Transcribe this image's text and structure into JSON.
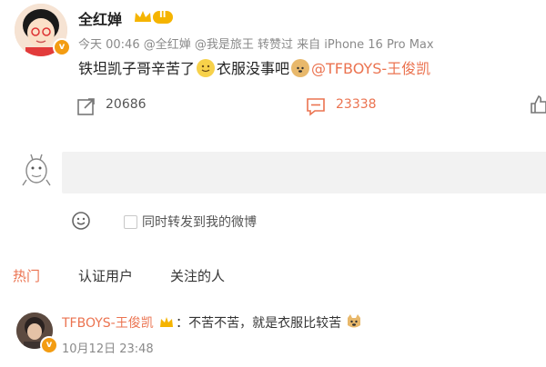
{
  "post": {
    "username": "全红婵",
    "vip_label": "II",
    "meta": "今天 00:46 @全红婵 @我是旅王 转赞过  来自 iPhone 16 Pro Max",
    "text_before": "铁坦凯子哥辛苦了",
    "text_middle": "衣服没事吧",
    "mention": "@TFBOYS-王俊凯",
    "emoji_1": "smile-emoji",
    "emoji_2": "doge-emoji"
  },
  "actions": {
    "repost_count": "20686",
    "comment_count": "23338"
  },
  "composer": {
    "placeholder": "",
    "also_repost_label": "同时转发到我的微博"
  },
  "tabs": [
    {
      "label": "热门",
      "active": true
    },
    {
      "label": "认证用户",
      "active": false
    },
    {
      "label": "关注的人",
      "active": false
    }
  ],
  "reply": {
    "username": "TFBOYS-王俊凯",
    "text": "：不苦不苦，就是衣服比较苦",
    "time": "10月12日 23:48"
  },
  "colors": {
    "accent": "#eb7350",
    "verified": "#f39c12"
  }
}
